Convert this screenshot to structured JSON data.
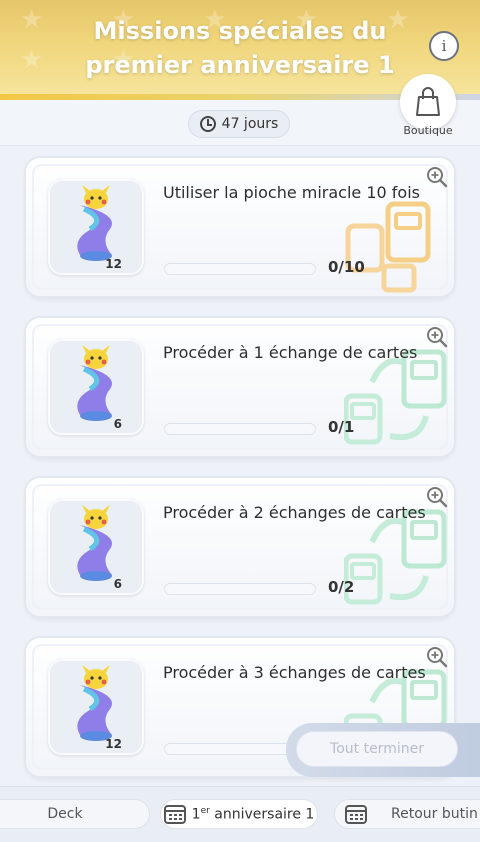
{
  "header": {
    "title": "Missions spéciales du premier anniversaire 1",
    "timer": "47 jours",
    "shop_label": "Boutique"
  },
  "missions": [
    {
      "text": "Utiliser la pioche miracle 10 fois",
      "reward_count": "12",
      "progress_text": "0/10",
      "progress": 0
    },
    {
      "text": "Procéder à 1 échange de cartes",
      "reward_count": "6",
      "progress_text": "0/1",
      "progress": 0
    },
    {
      "text": "Procéder à 2 échanges de cartes",
      "reward_count": "6",
      "progress_text": "0/2",
      "progress": 0
    },
    {
      "text": "Procéder à 3 échanges de cartes",
      "reward_count": "12",
      "progress_text": "",
      "progress": 0
    }
  ],
  "complete_all_label": "Tout terminer",
  "bottom_nav": {
    "deck": "Deck",
    "anniversary_prefix": "1",
    "anniversary_sup": "er",
    "anniversary_rest": " anniversaire 1",
    "butin": "Retour butin"
  },
  "colors": {
    "header_gold": "#f0d57a",
    "deco_orange": "#f5c97a",
    "deco_green": "#b8e8cf",
    "progress_track": "#f6f8fc"
  }
}
